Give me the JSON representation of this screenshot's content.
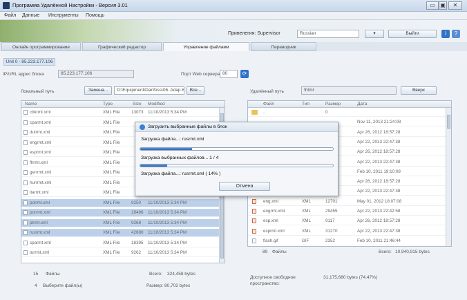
{
  "window": {
    "title": "Программа Удалённой Настройки - Версия 3.01",
    "controls": [
      "▭",
      "▣",
      "✕"
    ]
  },
  "menu": [
    "Файл",
    "Данные",
    "Инструменты",
    "Помощь"
  ],
  "header": {
    "user_label": "Привелегия: Supervisor",
    "language": "Russian",
    "logout": "Выйти",
    "info_icon": "i"
  },
  "tabs": [
    "Онлайн программирование",
    "Графический редактор",
    "Управление файлами",
    "Переводчик"
  ],
  "subtab": "Unit 0 - 85.223.177.106",
  "connection": {
    "ip_label": "IP/URL адрес блока",
    "ip_value": "85.223.177.106",
    "port_label": "Порт Web сервера",
    "port_value": "80",
    "connect_icon": "connect-icon"
  },
  "local": {
    "path_label": "Локальный путь",
    "change_btn": "Замена...",
    "path_value": "D:\\Equipment\\Danfoss\\06. Adap Kool\\35",
    "all_btn": "Все...",
    "columns": [
      "Name",
      "Type",
      "Size",
      "Modified"
    ],
    "rows": [
      {
        "name": "cbkrmt.xml",
        "type": "XML File",
        "size": "13073",
        "mod": "11/10/2013 5:34 PM",
        "sel": false
      },
      {
        "name": "cparmt.xml",
        "type": "XML File",
        "size": "",
        "mod": "",
        "sel": false
      },
      {
        "name": "dutrmt.xml",
        "type": "XML File",
        "size": "",
        "mod": "",
        "sel": false
      },
      {
        "name": "engrmt.xml",
        "type": "XML File",
        "size": "",
        "mod": "",
        "sel": false
      },
      {
        "name": "esprmt.xml",
        "type": "XML File",
        "size": "",
        "mod": "",
        "sel": false
      },
      {
        "name": "fhrmt.xml",
        "type": "XML File",
        "size": "",
        "mod": "",
        "sel": false
      },
      {
        "name": "genrmt.xml",
        "type": "XML File",
        "size": "",
        "mod": "",
        "sel": false
      },
      {
        "name": "hunrmt.xml",
        "type": "XML File",
        "size": "",
        "mod": "",
        "sel": false
      },
      {
        "name": "itarmt.xml",
        "type": "XML File",
        "size": "",
        "mod": "",
        "sel": false
      },
      {
        "name": "polrmt.xml",
        "type": "XML File",
        "size": "9250",
        "mod": "11/10/2013 5:34 PM",
        "sel": true
      },
      {
        "name": "porrmt.xml",
        "type": "XML File",
        "size": "19496",
        "mod": "11/10/2013 5:34 PM",
        "sel": true
      },
      {
        "name": "ptrmt.xml",
        "type": "XML File",
        "size": "9268",
        "mod": "11/10/2013 5:34 PM",
        "sel": true
      },
      {
        "name": "rusrmt.xml",
        "type": "XML File",
        "size": "42680",
        "mod": "11/10/2013 5:34 PM",
        "sel": true
      },
      {
        "name": "sparmt.xml",
        "type": "XML File",
        "size": "18395",
        "mod": "11/10/2013 5:34 PM",
        "sel": false
      },
      {
        "name": "turrmt.xml",
        "type": "XML File",
        "size": "9262",
        "mod": "11/10/2013 5:34 PM",
        "sel": false
      }
    ],
    "files_count": "15",
    "files_label": "Файлы",
    "total_label": "Всего:",
    "total_value": "324,458 bytes",
    "selected_count": "4",
    "selected_label": "Выберите файл(ы)",
    "size_label": "Размер:",
    "size_value": "80,702 bytes"
  },
  "remote": {
    "path_label": "Удалённый путь",
    "path_value": "\\html",
    "all_btn": "Вверх",
    "columns": [
      "Файл",
      "Тип",
      "Размер",
      "Дата"
    ],
    "rows": [
      {
        "name": "..",
        "type": "",
        "size": "0",
        "date": "",
        "kind": "folder"
      },
      {
        "name": "",
        "type": "",
        "size": "",
        "date": "Nov 11, 2013 21:24:08",
        "kind": "none"
      },
      {
        "name": "",
        "type": "",
        "size": "",
        "date": "Apr 26, 2012 18:57:28",
        "kind": "none"
      },
      {
        "name": "",
        "type": "",
        "size": "",
        "date": "Apr 22, 2013 22:47:38",
        "kind": "none"
      },
      {
        "name": "",
        "type": "",
        "size": "",
        "date": "Apr 26, 2012 18:57:28",
        "kind": "none"
      },
      {
        "name": "",
        "type": "",
        "size": "",
        "date": "Apr 22, 2013 22:47:38",
        "kind": "none"
      },
      {
        "name": "",
        "type": "",
        "size": "3",
        "date": "Feb 10, 2011 19:10:08",
        "kind": "none"
      },
      {
        "name": "",
        "type": "",
        "size": "",
        "date": "Apr 26, 2012 18:57:28",
        "kind": "none"
      },
      {
        "name": "",
        "type": "",
        "size": "",
        "date": "Apr 22, 2013 22:47:38",
        "kind": "none"
      },
      {
        "name": "eng.xml",
        "type": "XML",
        "size": "12701",
        "date": "May 01, 2012 18:07:08",
        "kind": "xml"
      },
      {
        "name": "engrmt.xml",
        "type": "XML",
        "size": "29455",
        "date": "Apr 22, 2013 22:42:58",
        "kind": "xml"
      },
      {
        "name": "esp.xml",
        "type": "XML",
        "size": "9117",
        "date": "Apr 26, 2012 18:57:28",
        "kind": "xml"
      },
      {
        "name": "esprmt.xml",
        "type": "XML",
        "size": "31270",
        "date": "Apr 22, 2013 22:47:38",
        "kind": "xml"
      },
      {
        "name": "flash.gif",
        "type": "GIF",
        "size": "2352",
        "date": "Feb 10, 2011 21:46:44",
        "kind": "gif"
      }
    ],
    "files_count": "89",
    "files_label": "Файлы",
    "total_label": "Всего:",
    "total_value": "10,940,915 bytes",
    "free_label": "Доступное свободное пространство:",
    "free_value": "31,175,680 bytes (74.47%)"
  },
  "dialog": {
    "title": "Загрузить выбранные файлы в блок",
    "line1": "Загрузка файла...: rusrmt.xml",
    "progress1": 0.27,
    "line2": "Загрузка выбранных файлов... 1 / 4",
    "progress2": 0.14,
    "line3": "Загрузка файла...: rusrmt.xml ( 14% )",
    "cancel": "Отмена"
  }
}
